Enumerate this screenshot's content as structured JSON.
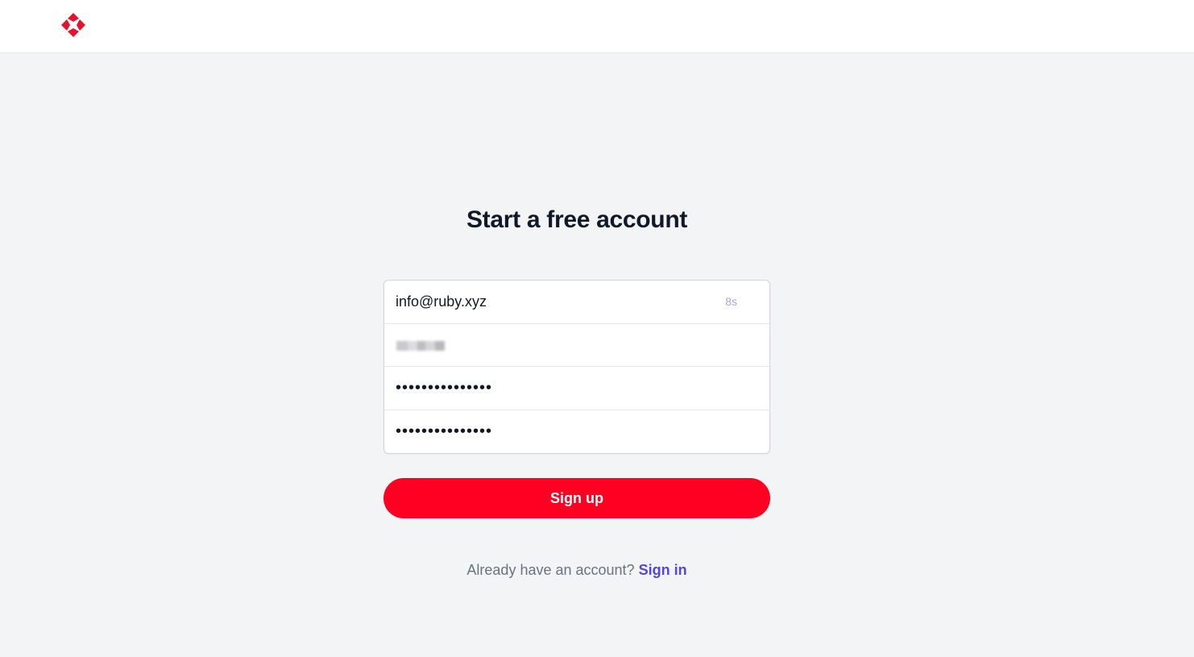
{
  "header": {
    "logo_icon": "ruby-diamond-logo-icon",
    "brand_color": "#e8112d"
  },
  "main": {
    "title": "Start a free account",
    "form": {
      "email_value": "info@ruby.xyz",
      "email_badge": "8s",
      "name_value": "",
      "password_value": "•••••••••••••••",
      "confirm_password_value": "•••••••••••••••"
    },
    "signup_label": "Sign up",
    "footer_prompt": "Already have an account?",
    "signin_label": "Sign in"
  },
  "colors": {
    "page_bg": "#f3f4f6",
    "button": "#ff0022",
    "link": "#4f46e5",
    "title": "#111827"
  }
}
